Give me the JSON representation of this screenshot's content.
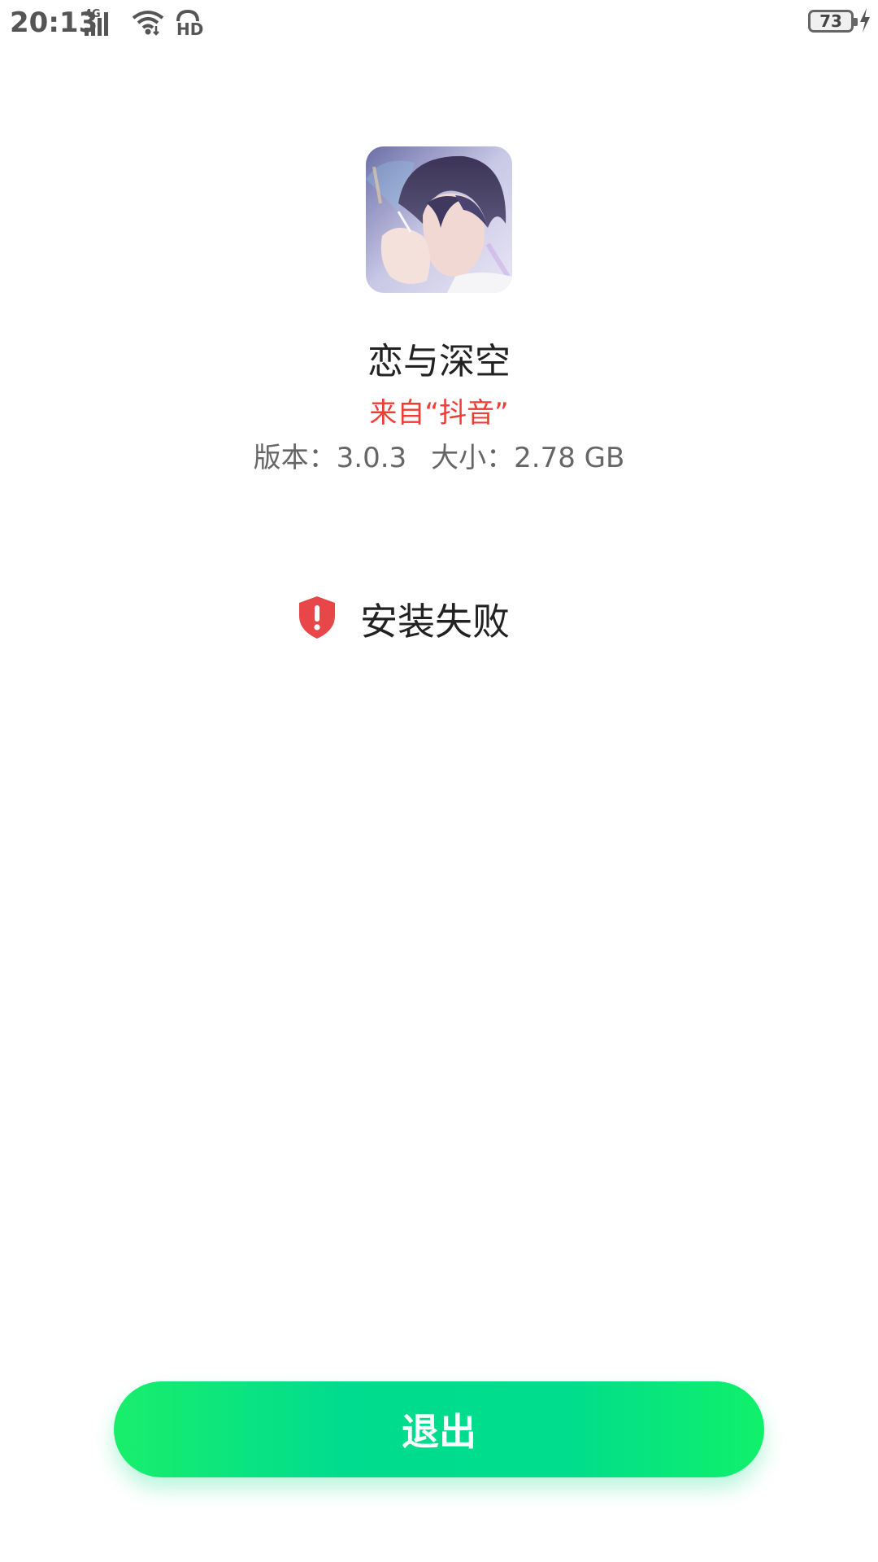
{
  "status_bar": {
    "time": "20:13",
    "network_label": "4G",
    "hd_label": "HD",
    "battery_level": "73",
    "icons": [
      "signal-icon",
      "wifi-icon",
      "hd-call-icon",
      "battery-icon",
      "charging-icon"
    ]
  },
  "app": {
    "icon": "app-icon-portrait",
    "name": "恋与深空",
    "source": "来自“抖音”",
    "version_label": "版本：3.0.3",
    "size_label": "大小：2.78 GB"
  },
  "install_status": {
    "icon": "shield-alert-icon",
    "text": "安装失败",
    "icon_color": "#e8474a"
  },
  "actions": {
    "exit_label": "退出",
    "button_color": "#00dd8c"
  }
}
